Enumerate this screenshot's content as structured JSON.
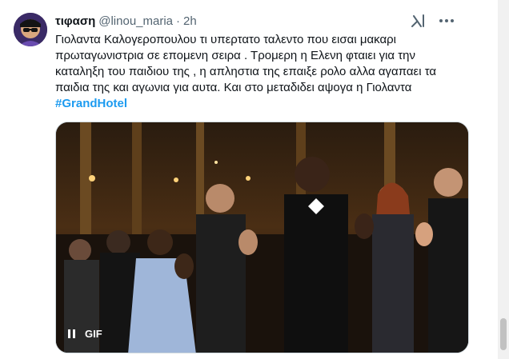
{
  "tweet": {
    "display_name": "τιφαση",
    "handle": "@linou_maria",
    "separator": "·",
    "time": "2h",
    "text_lines": [
      "Γιολαντα Καλογεροπουλου τι υπερτατο ταλεντο που εισαι μακαρι",
      "πρωταγωνιστρια σε επομενη σειρα . Τρομερη η Ελενη φταιει για την",
      "καταληξη του παιδιου της , η απληστια της επαιξε ρολο αλλα αγαπαει τα",
      "παιδια της και αγωνια για αυτα. Και στο μεταδιδει αψογα η Γιολαντα"
    ],
    "hashtag": "#GrandHotel",
    "media": {
      "badge": "GIF"
    }
  },
  "icons": {
    "grok": "grok-icon",
    "more": "more-dots-icon",
    "pause": "pause-icon"
  },
  "colors": {
    "link": "#1d9bf0",
    "secondary_text": "#536471",
    "primary_text": "#0f1419"
  }
}
